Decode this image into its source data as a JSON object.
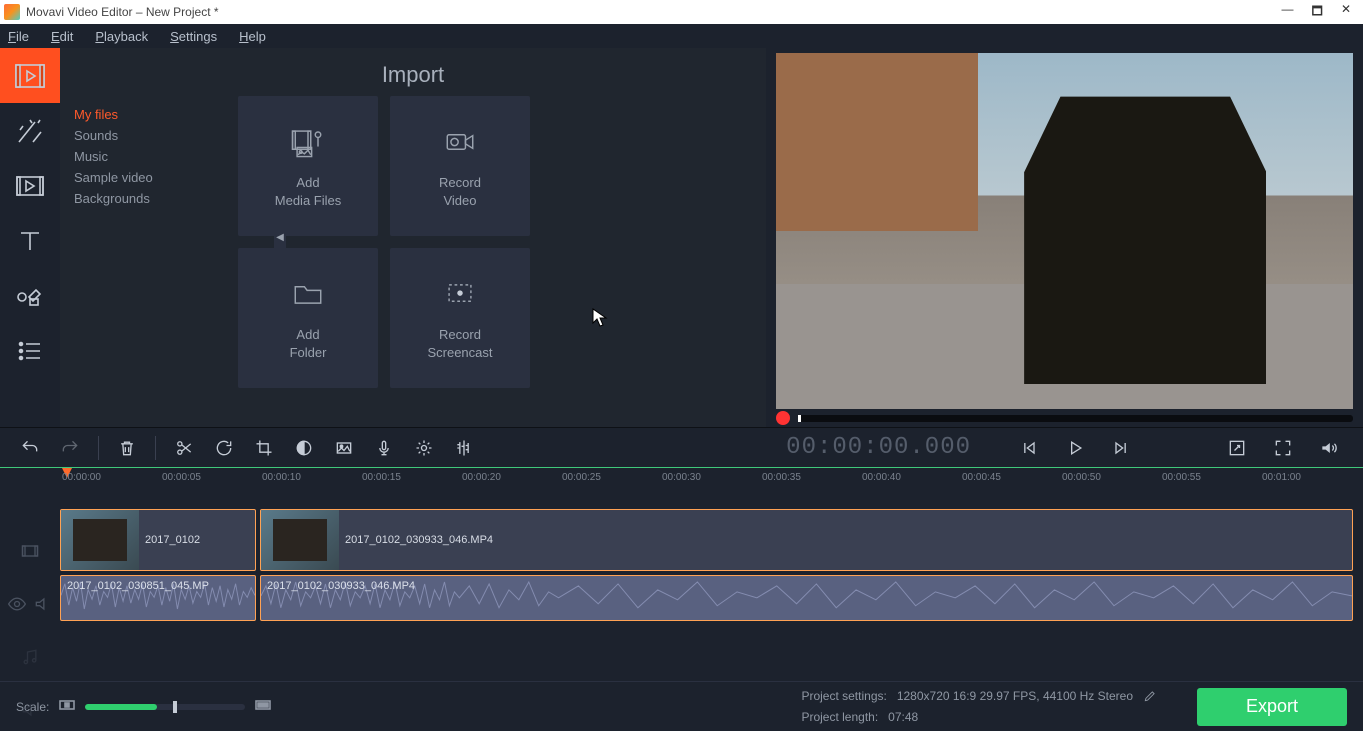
{
  "titlebar": {
    "app_title": "Movavi Video Editor – New Project *"
  },
  "window_controls": {
    "min": "—",
    "max": "🗖",
    "close": "✕"
  },
  "menu": {
    "file": "File",
    "edit": "Edit",
    "playback": "Playback",
    "settings": "Settings",
    "help": "Help"
  },
  "import": {
    "title": "Import",
    "list": {
      "my_files": "My files",
      "sounds": "Sounds",
      "music": "Music",
      "sample_video": "Sample video",
      "backgrounds": "Backgrounds"
    },
    "tiles": {
      "add_media": "Add\nMedia Files",
      "record_video": "Record\nVideo",
      "add_folder": "Add\nFolder",
      "record_screencast": "Record\nScreencast"
    }
  },
  "playback": {
    "timecode": "00:00:00.000"
  },
  "ruler": {
    "ticks": [
      "00:00:00",
      "00:00:05",
      "00:00:10",
      "00:00:15",
      "00:00:20",
      "00:00:25",
      "00:00:30",
      "00:00:35",
      "00:00:40",
      "00:00:45",
      "00:00:50",
      "00:00:55",
      "00:01:00"
    ]
  },
  "clips": {
    "v1": "2017_0102",
    "v2": "2017_0102_030933_046.MP4",
    "a1": "2017_0102_030851_045.MP",
    "a2": "2017_0102_030933_046.MP4"
  },
  "status": {
    "scale_label": "Scale:",
    "project_settings_label": "Project settings:",
    "project_settings_value": "1280x720 16:9 29.97 FPS, 44100 Hz Stereo",
    "project_length_label": "Project length:",
    "project_length_value": "07:48",
    "export": "Export"
  }
}
